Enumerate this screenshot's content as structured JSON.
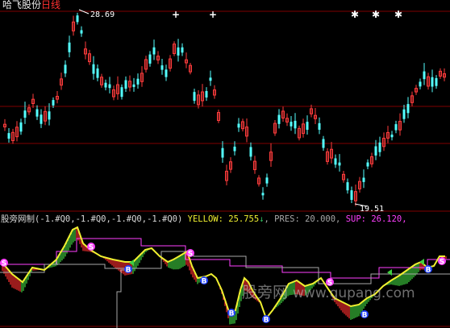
{
  "header": {
    "stock_name": "哈飞股份",
    "period": "日线"
  },
  "price_panel": {
    "max_label": "28.69",
    "min_label": "19.51",
    "signal_marks": [
      {
        "glyph": "+",
        "color": "#ffffff"
      },
      {
        "glyph": "+",
        "color": "#ffffff"
      },
      {
        "glyph": "✱",
        "color": "#ffffff"
      },
      {
        "glyph": "✱",
        "color": "#ffffff"
      },
      {
        "glyph": "✱",
        "color": "#ffffff"
      }
    ]
  },
  "indicator": {
    "name": "股旁网制",
    "params": "(-1.#Q0,-1.#Q0,-1.#Q0,-1.#Q0)",
    "yellow_label": "YELLOW:",
    "yellow_value": "25.755",
    "yellow_arrow": "↓",
    "pres_label": "PRES:",
    "pres_value": "20.000",
    "sup_label": "SUP:",
    "sup_value": "26.120",
    "trailing": ","
  },
  "markers": {
    "buy_glyph": "B",
    "sell_glyph": "S"
  },
  "watermark": {
    "text_cn": "股旁网",
    "url": "www.gupang.com"
  },
  "colors": {
    "background": "#000000",
    "candle_up": "#ff3c3c",
    "candle_down": "#54ffff",
    "grid": "#800000",
    "yellow_line": "#f0f030",
    "pres_line": "#a8a8a8",
    "sup_line": "#ff40ff",
    "band_up": "#40d040",
    "band_down": "#ff3030",
    "buy_marker": "#2040ff",
    "sell_marker": "#ff40ff"
  }
}
